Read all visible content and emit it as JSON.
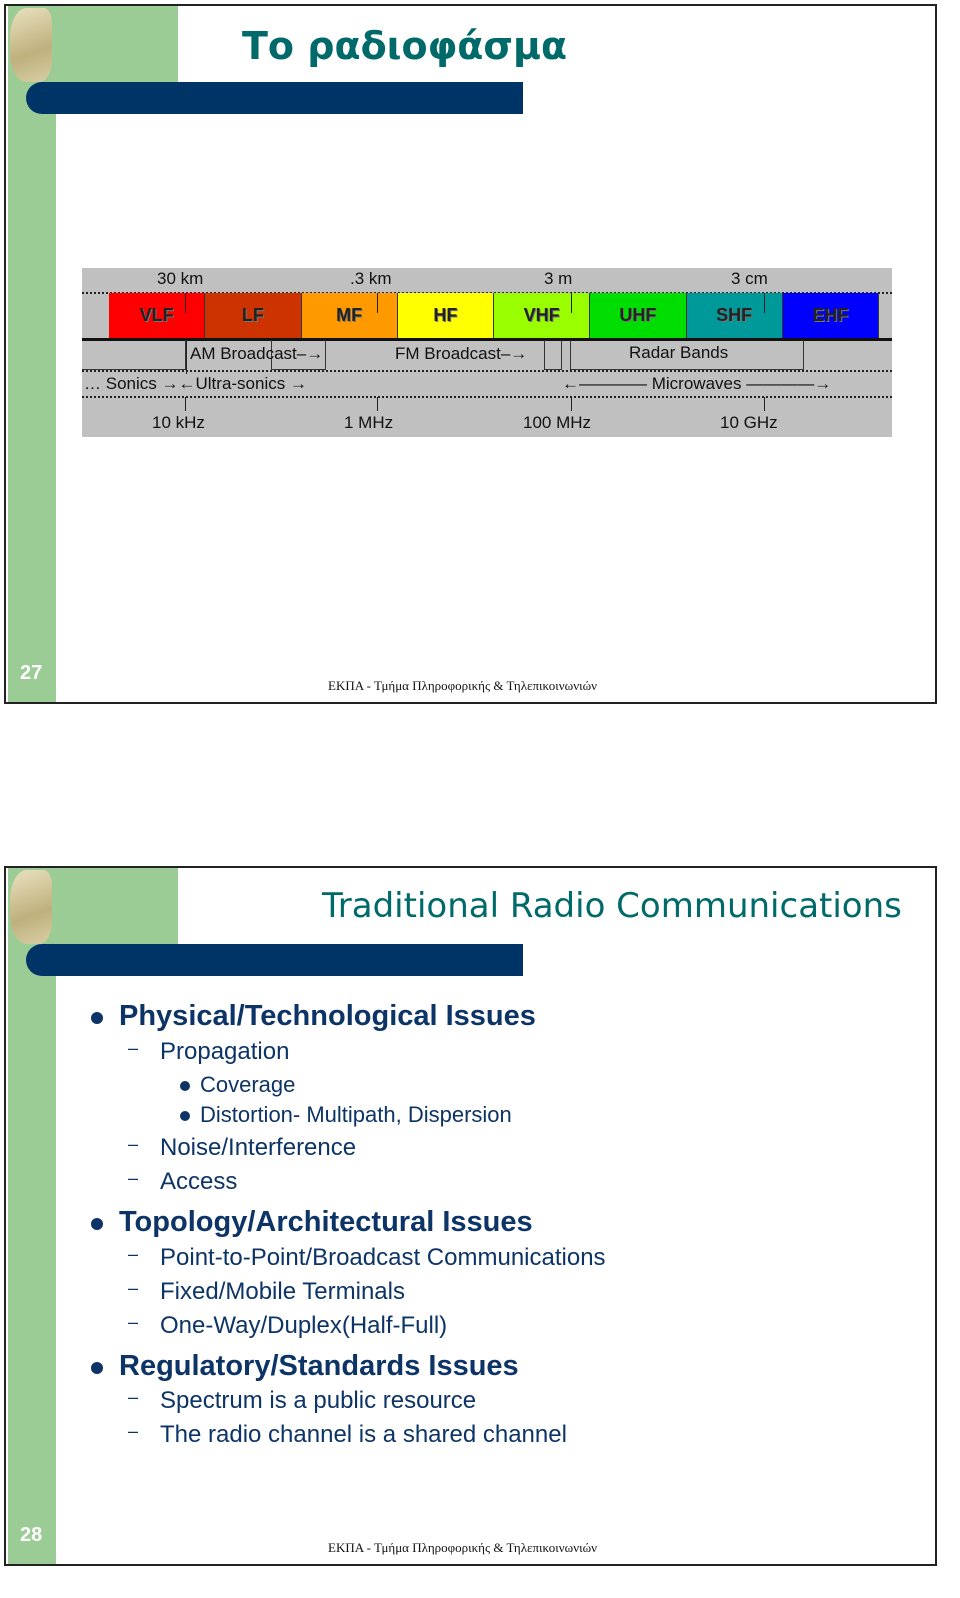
{
  "slides": [
    {
      "number": "27",
      "title": "Το ραδιοφάσμα",
      "footer": "ΕΚΠΑ - Τμήμα Πληροφορικής & Τηλεπικοινωνιών",
      "spectrum": {
        "wavelengths": [
          "30 km",
          ".3 km",
          "3 m",
          "3 cm"
        ],
        "bands": [
          {
            "label": "VLF",
            "color": "#ff0000"
          },
          {
            "label": "LF",
            "color": "#cc3300"
          },
          {
            "label": "MF",
            "color": "#ff9900"
          },
          {
            "label": "HF",
            "color": "#ffff00"
          },
          {
            "label": "VHF",
            "color": "#99ff00"
          },
          {
            "label": "UHF",
            "color": "#00dd00"
          },
          {
            "label": "SHF",
            "color": "#009999"
          },
          {
            "label": "EHF",
            "color": "#0000ff"
          }
        ],
        "services": [
          "AM Broadcast",
          "FM Broadcast",
          "Radar Bands"
        ],
        "ranges": [
          "Sonics",
          "Ultra-sonics",
          "Microwaves"
        ],
        "frequencies": [
          "10 kHz",
          "1 MHz",
          "100 MHz",
          "10 GHz"
        ]
      }
    },
    {
      "number": "28",
      "title": "Traditional Radio Communications",
      "footer": "ΕΚΠΑ - Τμήμα Πληροφορικής & Τηλεπικοινωνιών",
      "bullets": [
        {
          "level": 1,
          "text": "Physical/Technological Issues"
        },
        {
          "level": 2,
          "text": "Propagation"
        },
        {
          "level": 3,
          "text": "Coverage"
        },
        {
          "level": 3,
          "text": "Distortion- Multipath, Dispersion"
        },
        {
          "level": 2,
          "text": "Noise/Interference"
        },
        {
          "level": 2,
          "text": "Access"
        },
        {
          "level": 1,
          "text": "Topology/Architectural Issues"
        },
        {
          "level": 2,
          "text": "Point-to-Point/Broadcast Communications"
        },
        {
          "level": 2,
          "text": "Fixed/Mobile Terminals"
        },
        {
          "level": 2,
          "text": "One-Way/Duplex(Half-Full)"
        },
        {
          "level": 1,
          "text": "Regulatory/Standards Issues"
        },
        {
          "level": 2,
          "text": "Spectrum is a public resource"
        },
        {
          "level": 2,
          "text": "The radio channel is a shared channel"
        }
      ]
    }
  ]
}
